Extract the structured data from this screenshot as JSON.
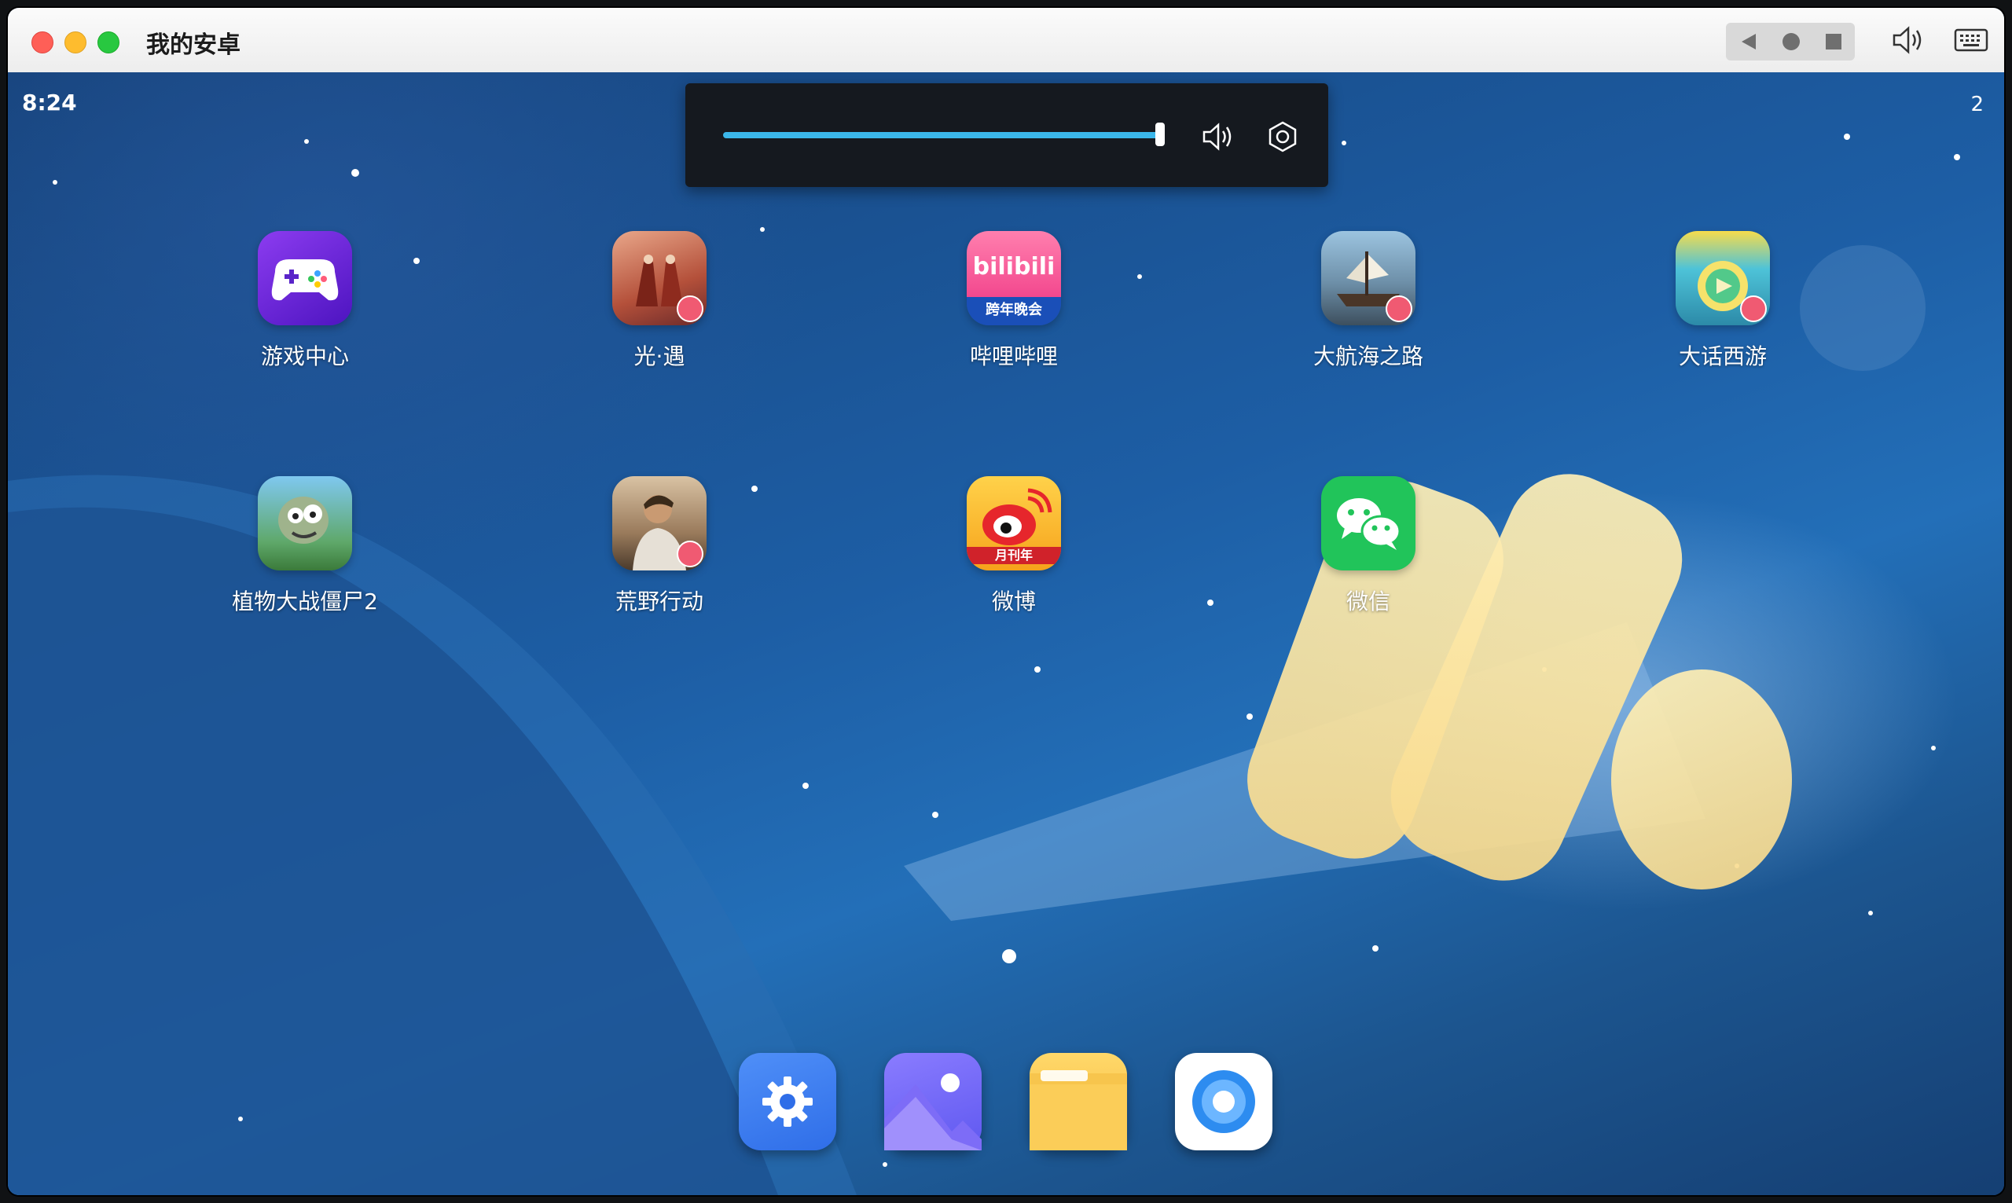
{
  "window": {
    "title": "我的安卓",
    "controls": [
      "close",
      "minimize",
      "maximize"
    ],
    "toolbar_icons": [
      "back-icon",
      "home-icon",
      "recents-icon",
      "volume-icon",
      "keyboard-icon"
    ]
  },
  "status_bar": {
    "time": "8:24",
    "right_indicator": "2"
  },
  "volume_panel": {
    "level": 1.0,
    "accent": "#3bb7ea",
    "icons": [
      "speaker-icon",
      "settings-icon"
    ]
  },
  "apps_row1": [
    {
      "label": "游戏中心",
      "icon": "gamepad-icon"
    },
    {
      "label": "光·遇",
      "icon": "sky-game-icon"
    },
    {
      "label": "哔哩哔哩",
      "icon": "bilibili-icon",
      "icon_text": "bilibili",
      "icon_subtext": "跨年晚会"
    },
    {
      "label": "大航海之路",
      "icon": "ship-icon"
    },
    {
      "label": "大话西游",
      "icon": "xiyou-icon"
    }
  ],
  "apps_row2": [
    {
      "label": "植物大战僵尸2",
      "icon": "zombie-icon"
    },
    {
      "label": "荒野行动",
      "icon": "soldier-icon"
    },
    {
      "label": "微博",
      "icon": "weibo-icon",
      "icon_subtext": "月刊年"
    },
    {
      "label": "微信",
      "icon": "wechat-icon"
    }
  ],
  "dock": [
    {
      "name": "settings",
      "icon": "gear-icon"
    },
    {
      "name": "gallery",
      "icon": "photo-icon"
    },
    {
      "name": "files",
      "icon": "folder-icon"
    },
    {
      "name": "browser",
      "icon": "browser-icon"
    }
  ],
  "colors": {
    "wallpaper": "#1d5ea5",
    "titlebar": "#f2f2f2"
  }
}
